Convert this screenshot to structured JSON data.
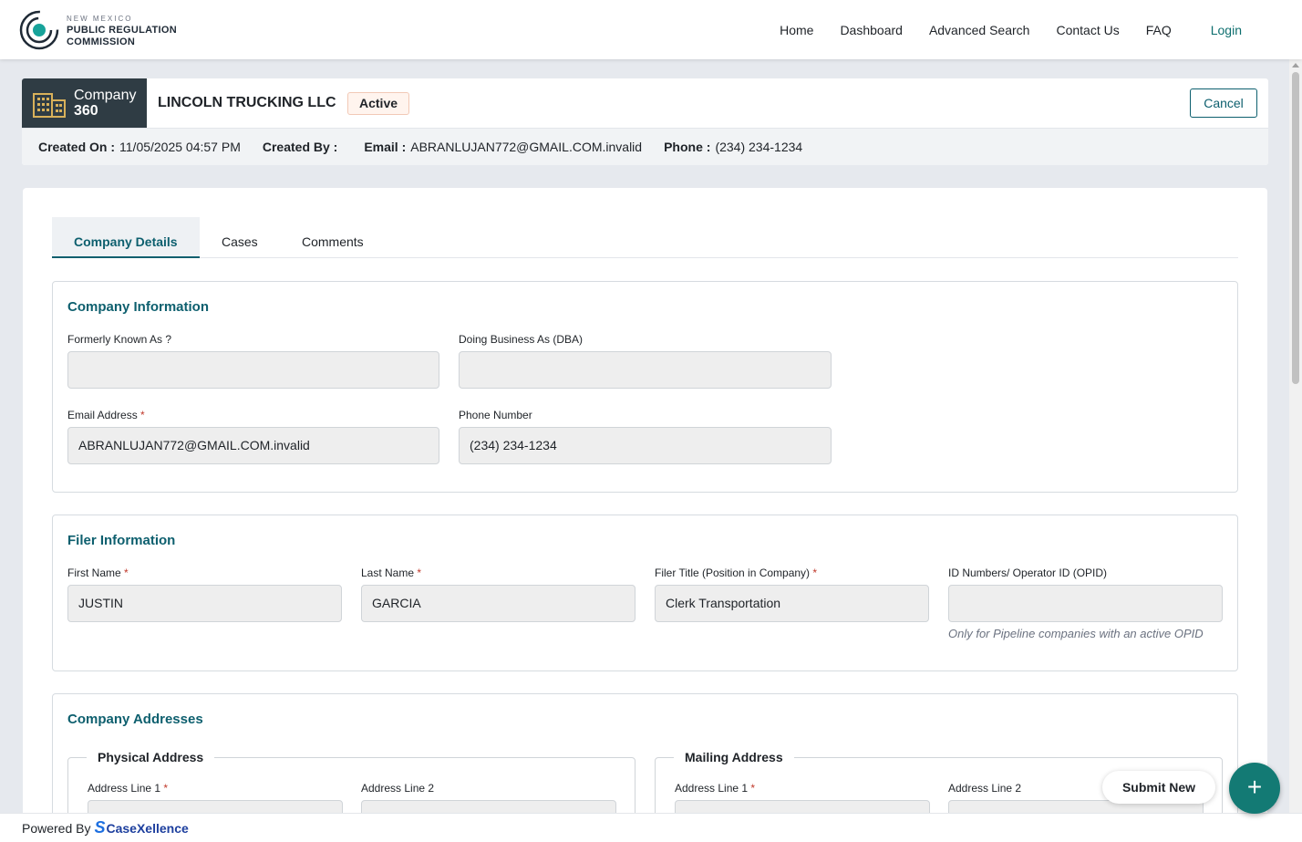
{
  "header": {
    "logo_line1": "NEW MEXICO",
    "logo_line2": "PUBLIC REGULATION",
    "logo_line3": "COMMISSION",
    "nav": [
      "Home",
      "Dashboard",
      "Advanced Search",
      "Contact Us",
      "FAQ"
    ],
    "login": "Login"
  },
  "company": {
    "badge_line1": "Company",
    "badge_line2": "360",
    "name": "LINCOLN TRUCKING LLC",
    "status": "Active",
    "cancel": "Cancel",
    "created_on_label": "Created On :",
    "created_on": "11/05/2025 04:57 PM",
    "created_by_label": "Created By :",
    "created_by": "",
    "email_label": "Email :",
    "email": "ABRANLUJAN772@GMAIL.COM.invalid",
    "phone_label": "Phone :",
    "phone": "(234) 234-1234"
  },
  "tabs": [
    "Company Details",
    "Cases",
    "Comments"
  ],
  "company_info": {
    "title": "Company Information",
    "fka_label": "Formerly Known As ?",
    "fka_value": "",
    "dba_label": "Doing Business As (DBA)",
    "dba_value": "",
    "email_label": "Email Address",
    "email_value": "ABRANLUJAN772@GMAIL.COM.invalid",
    "phone_label": "Phone Number",
    "phone_value": "(234) 234-1234"
  },
  "filer_info": {
    "title": "Filer Information",
    "first_label": "First Name",
    "first_value": "JUSTIN",
    "last_label": "Last Name",
    "last_value": "GARCIA",
    "title_label": "Filer Title (Position in Company)",
    "title_value": "Clerk Transportation",
    "opid_label": "ID Numbers/ Operator ID (OPID)",
    "opid_value": "",
    "opid_hint": "Only for Pipeline companies with an active OPID"
  },
  "addresses": {
    "title": "Company Addresses",
    "physical": "Physical Address",
    "mailing": "Mailing Address",
    "line1_label": "Address Line 1",
    "line2_label": "Address Line 2"
  },
  "required_marker": "*",
  "submit_new": "Submit New",
  "fab_icon": "+",
  "footer": {
    "powered_by": "Powered By",
    "brand": "CaseXellence"
  }
}
